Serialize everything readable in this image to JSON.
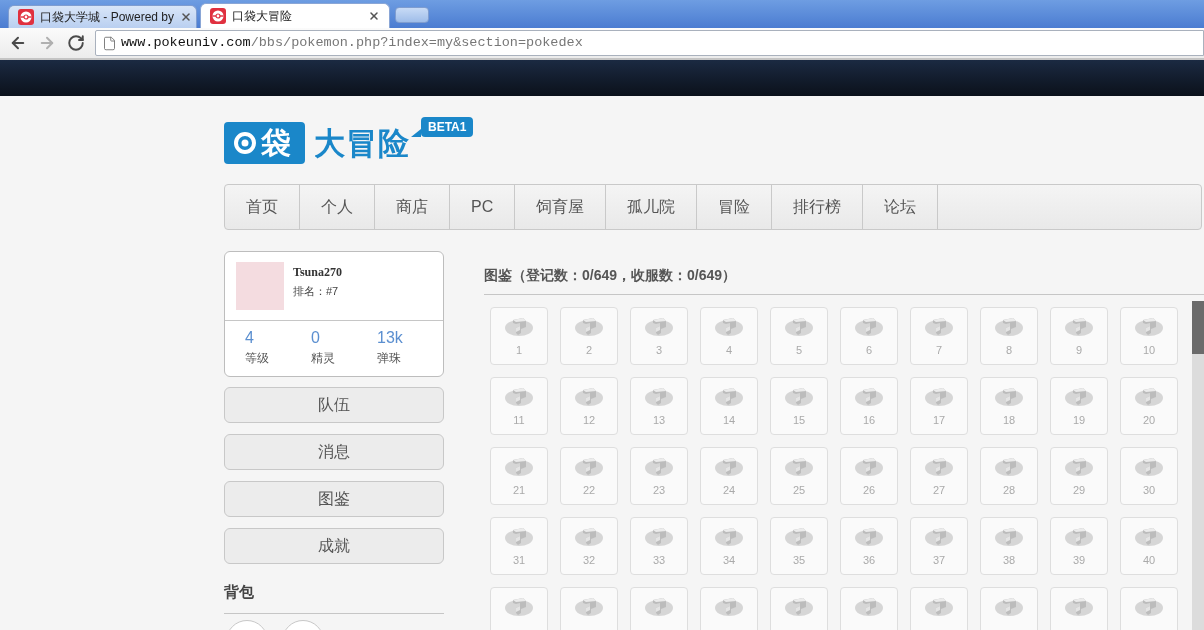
{
  "browser": {
    "tabs": [
      {
        "title": "口袋大学城 - Powered by",
        "selected": false
      },
      {
        "title": "口袋大冒险",
        "selected": true
      }
    ],
    "nav_buttons": [
      {
        "kind": "back",
        "disabled": false
      },
      {
        "kind": "forward",
        "disabled": true
      },
      {
        "kind": "reload",
        "disabled": false
      }
    ],
    "address": {
      "host": "www.pokeuniv.com",
      "path": "/bbs/pokemon.php?index=my&section=pokedex"
    }
  },
  "logo": {
    "mark": "袋",
    "title": "大冒险",
    "badge": "BETA1"
  },
  "nav": [
    {
      "label": "首页",
      "selected": false
    },
    {
      "label": "个人",
      "selected": false
    },
    {
      "label": "商店",
      "selected": false
    },
    {
      "label": "PC",
      "selected": false
    },
    {
      "label": "饲育屋",
      "selected": false
    },
    {
      "label": "孤儿院",
      "selected": false
    },
    {
      "label": "冒险",
      "selected": false
    },
    {
      "label": "排行榜",
      "selected": false
    },
    {
      "label": "论坛",
      "selected": false
    }
  ],
  "profile": {
    "name": "Tsuna270",
    "rank": "排名：#7",
    "stats": [
      {
        "value": "4",
        "label": "等级"
      },
      {
        "value": "0",
        "label": "精灵"
      },
      {
        "value": "13k",
        "label": "弹珠"
      }
    ]
  },
  "menu": [
    "队伍",
    "消息",
    "图鉴",
    "成就"
  ],
  "bag": {
    "title": "背包",
    "slots": [
      {
        "empty": true
      },
      {
        "empty": true
      }
    ]
  },
  "pokedex": {
    "title": "图鉴（登记数：0/649，收服数：0/649）",
    "entries": [
      {
        "kind": "numbered",
        "number": "1"
      },
      {
        "kind": "numbered",
        "number": "2"
      },
      {
        "kind": "numbered",
        "number": "3"
      },
      {
        "kind": "numbered",
        "number": "4"
      },
      {
        "kind": "numbered",
        "number": "5"
      },
      {
        "kind": "numbered",
        "number": "6"
      },
      {
        "kind": "numbered",
        "number": "7"
      },
      {
        "kind": "numbered",
        "number": "8"
      },
      {
        "kind": "numbered",
        "number": "9"
      },
      {
        "kind": "numbered",
        "number": "10"
      },
      {
        "kind": "numbered",
        "number": "11"
      },
      {
        "kind": "numbered",
        "number": "12"
      },
      {
        "kind": "numbered",
        "number": "13"
      },
      {
        "kind": "numbered",
        "number": "14"
      },
      {
        "kind": "numbered",
        "number": "15"
      },
      {
        "kind": "numbered",
        "number": "16"
      },
      {
        "kind": "numbered",
        "number": "17"
      },
      {
        "kind": "numbered",
        "number": "18"
      },
      {
        "kind": "numbered",
        "number": "19"
      },
      {
        "kind": "numbered",
        "number": "20"
      },
      {
        "kind": "numbered",
        "number": "21"
      },
      {
        "kind": "numbered",
        "number": "22"
      },
      {
        "kind": "numbered",
        "number": "23"
      },
      {
        "kind": "numbered",
        "number": "24"
      },
      {
        "kind": "numbered",
        "number": "25"
      },
      {
        "kind": "numbered",
        "number": "26"
      },
      {
        "kind": "numbered",
        "number": "27"
      },
      {
        "kind": "numbered",
        "number": "28"
      },
      {
        "kind": "numbered",
        "number": "29"
      },
      {
        "kind": "numbered",
        "number": "30"
      },
      {
        "kind": "numbered",
        "number": "31"
      },
      {
        "kind": "numbered",
        "number": "32"
      },
      {
        "kind": "numbered",
        "number": "33"
      },
      {
        "kind": "numbered",
        "number": "34"
      },
      {
        "kind": "numbered",
        "number": "35"
      },
      {
        "kind": "numbered",
        "number": "36"
      },
      {
        "kind": "numbered",
        "number": "37"
      },
      {
        "kind": "numbered",
        "number": "38"
      },
      {
        "kind": "numbered",
        "number": "39"
      },
      {
        "kind": "numbered",
        "number": "40"
      },
      {
        "kind": "cut"
      },
      {
        "kind": "cut"
      },
      {
        "kind": "cut"
      },
      {
        "kind": "cut"
      },
      {
        "kind": "cut"
      },
      {
        "kind": "cut"
      },
      {
        "kind": "cut"
      },
      {
        "kind": "cut"
      },
      {
        "kind": "cut"
      },
      {
        "kind": "cut"
      }
    ]
  }
}
